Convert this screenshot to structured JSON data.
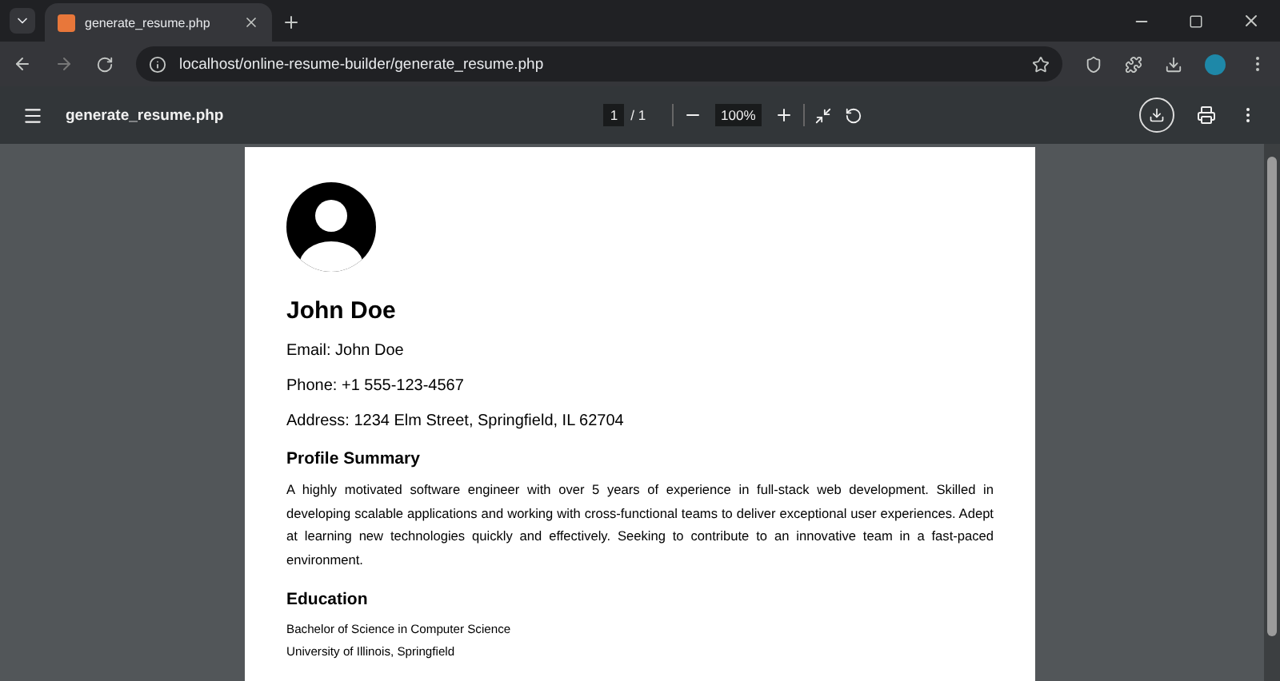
{
  "tab": {
    "title": "generate_resume.php",
    "selected": true
  },
  "address_bar": {
    "url": "localhost/online-resume-builder/generate_resume.php"
  },
  "pdf_toolbar": {
    "title": "generate_resume.php",
    "page": "1",
    "page_total": "/ 1",
    "zoom": "100%"
  },
  "resume": {
    "name": "John Doe",
    "contacts": [
      "Email: John Doe",
      "Phone: +1 555-123-4567",
      "Address: 1234 Elm Street, Springfield, IL 62704"
    ],
    "sections": [
      {
        "heading": "Profile Summary",
        "kind": "paragraph",
        "lines": [
          "A highly motivated software engineer with over 5 years of experience in full-stack web development. Skilled in developing scalable applications and working with cross-functional teams to deliver exceptional user experiences. Adept at learning new technologies quickly and effectively. Seeking to contribute to an innovative team in a fast-paced environment."
        ]
      },
      {
        "heading": "Education",
        "kind": "list",
        "lines": [
          "Bachelor of Science in Computer Science",
          "University of Illinois, Springfield"
        ]
      }
    ]
  }
}
